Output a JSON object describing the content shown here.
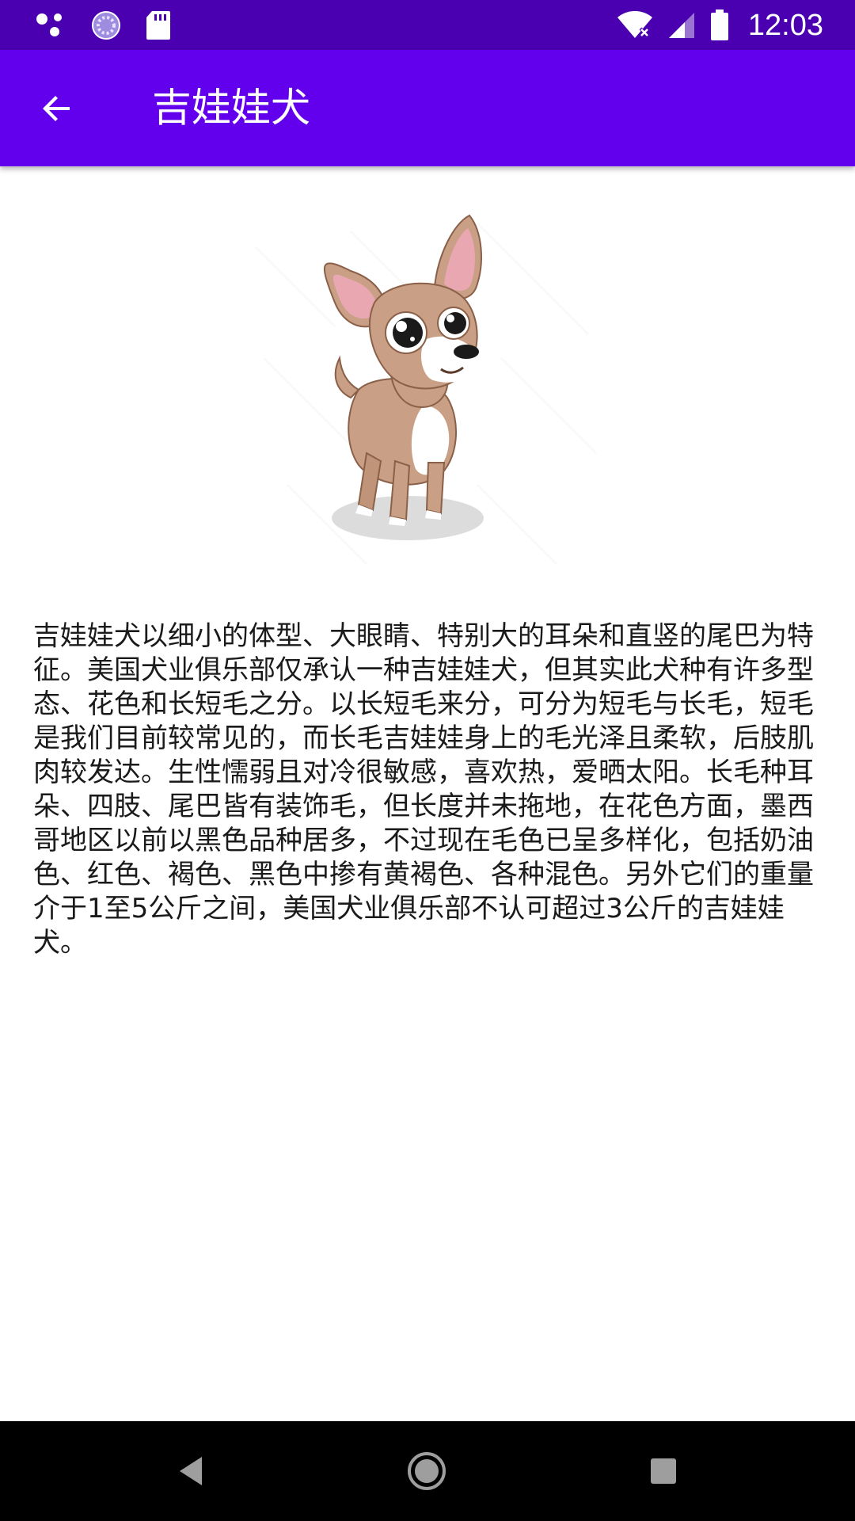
{
  "status_bar": {
    "time": "12:03",
    "icons_left": [
      "assistant-dots-icon",
      "sync-circle-icon",
      "sd-card-icon"
    ],
    "icons_right": [
      "wifi-icon",
      "signal-icon",
      "battery-icon"
    ]
  },
  "app_bar": {
    "title": "吉娃娃犬",
    "back_icon": "arrow-back-icon",
    "background": "#6200ee"
  },
  "content": {
    "image": "chihuahua-illustration",
    "description": "吉娃娃犬以细小的体型、大眼睛、特别大的耳朵和直竖的尾巴为特征。美国犬业俱乐部仅承认一种吉娃娃犬，但其实此犬种有许多型态、花色和长短毛之分。以长短毛来分，可分为短毛与长毛，短毛是我们目前较常见的，而长毛吉娃娃身上的毛光泽且柔软，后肢肌肉较发达。生性懦弱且对冷很敏感，喜欢热，爱晒太阳。长毛种耳朵、四肢、尾巴皆有装饰毛，但长度并未拖地，在花色方面，墨西哥地区以前以黑色品种居多，不过现在毛色已呈多样化，包括奶油色、红色、褐色、黑色中掺有黄褐色、各种混色。另外它们的重量介于1至5公斤之间，美国犬业俱乐部不认可超过3公斤的吉娃娃犬。"
  },
  "nav_bar": {
    "buttons": [
      "nav-back-icon",
      "nav-home-icon",
      "nav-recents-icon"
    ]
  },
  "colors": {
    "status_bar": "#4a00b0",
    "app_bar": "#6200ee",
    "nav_bar": "#000000"
  }
}
